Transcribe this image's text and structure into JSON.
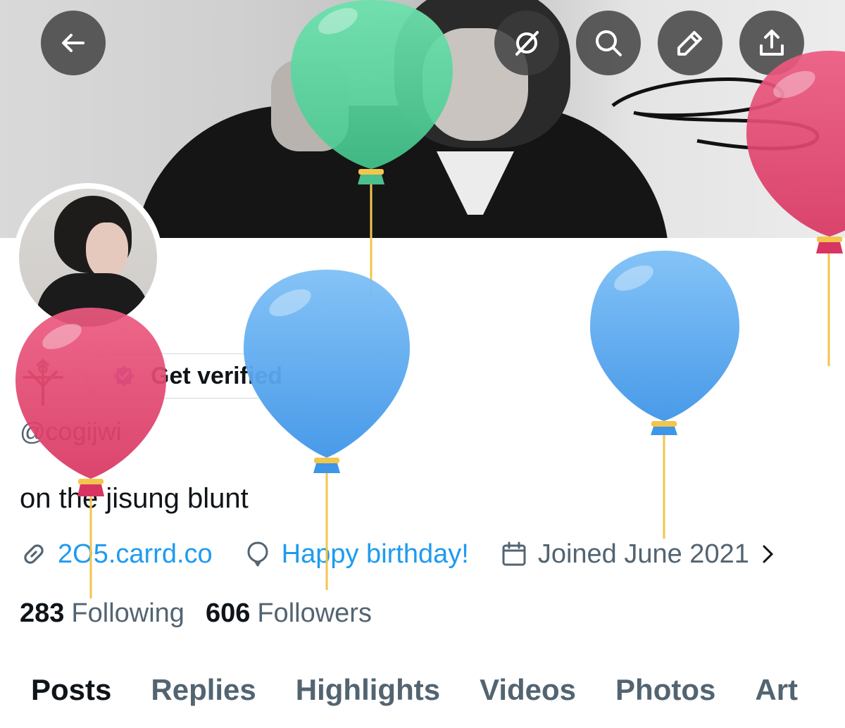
{
  "header": {
    "buttons": [
      {
        "name": "back",
        "icon": "arrow-left-icon"
      },
      {
        "name": "grok",
        "icon": "grok-slash-icon"
      },
      {
        "name": "search",
        "icon": "search-icon"
      },
      {
        "name": "edit",
        "icon": "pencil-icon"
      },
      {
        "name": "share",
        "icon": "share-upload-icon"
      }
    ]
  },
  "profile": {
    "verify_label": "Get verified",
    "handle": "@cogijwi",
    "bio": "on the jisung blunt",
    "website": "2O5.carrd.co",
    "birthday": "Happy birthday!",
    "joined": "Joined June 2021",
    "following_count": "283",
    "following_label": "Following",
    "followers_count": "606",
    "followers_label": "Followers"
  },
  "tabs": [
    "Posts",
    "Replies",
    "Highlights",
    "Videos",
    "Photos",
    "Art"
  ],
  "active_tab": "Posts",
  "colors": {
    "link": "#1d9bf0",
    "secondary_text": "#536471",
    "verified_badge": "#8e4fd1",
    "balloon_green": "#5dd6a0",
    "balloon_blue": "#5aa8ef",
    "balloon_red": "#e2436e"
  }
}
